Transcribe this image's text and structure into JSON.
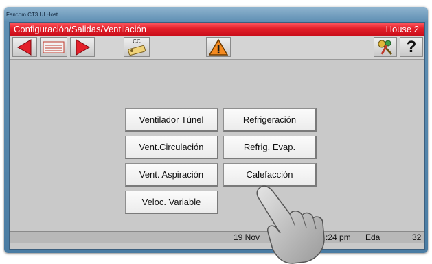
{
  "window": {
    "title": "Fancom.CT3.UI.Host"
  },
  "header": {
    "path": "Configuración/Salidas/Ventilación",
    "house": "House 2"
  },
  "toolbar": {
    "cc_label": "CC",
    "help_label": "?",
    "icons": [
      "arrow-left-icon",
      "record-list-icon",
      "arrow-right-icon",
      "cc-key-icon",
      "warning-icon",
      "keys-icon",
      "help-icon"
    ]
  },
  "menu": {
    "ventilador_tunel": "Ventilador Túnel",
    "refrigeracion": "Refrigeración",
    "vent_circulacion": "Vent.Circulación",
    "refrig_evap": "Refrig. Evap.",
    "vent_aspiracion": "Vent. Aspiración",
    "calefaccion": "Calefacción",
    "veloc_variable": "Veloc. Variable"
  },
  "status": {
    "date": "19 Nov",
    "time": ":24 pm",
    "user": "Eda",
    "number": "32"
  },
  "colors": {
    "header_red": "#e3202a",
    "arrow_red": "#e3202a",
    "warning_orange": "#f58a1f"
  }
}
